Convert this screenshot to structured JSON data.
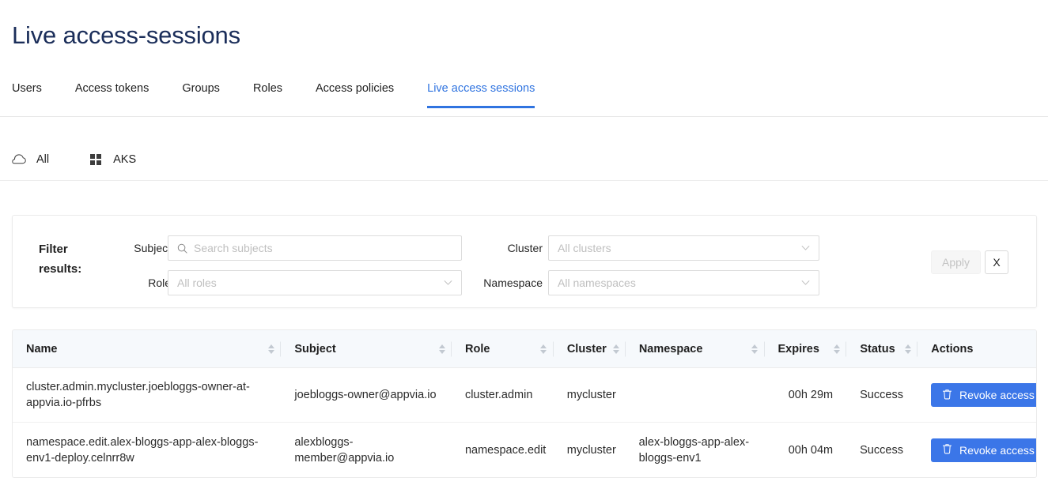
{
  "header": {
    "title": "Live access-sessions"
  },
  "tabs": [
    {
      "label": "Users",
      "active": false
    },
    {
      "label": "Access tokens",
      "active": false
    },
    {
      "label": "Groups",
      "active": false
    },
    {
      "label": "Roles",
      "active": false
    },
    {
      "label": "Access policies",
      "active": false
    },
    {
      "label": "Live access sessions",
      "active": true
    }
  ],
  "subtabs": [
    {
      "label": "All",
      "icon": "cloud-icon"
    },
    {
      "label": "AKS",
      "icon": "grid-icon"
    }
  ],
  "filter": {
    "title_line1": "Filter",
    "title_line2": "results:",
    "subject_label": "Subject",
    "subject_placeholder": "Search subjects",
    "role_label": "Role",
    "role_placeholder": "All roles",
    "cluster_label": "Cluster",
    "cluster_placeholder": "All clusters",
    "namespace_label": "Namespace",
    "namespace_placeholder": "All namespaces",
    "apply_label": "Apply",
    "clear_label": "X"
  },
  "table": {
    "columns": [
      {
        "label": "Name",
        "sortable": true
      },
      {
        "label": "Subject",
        "sortable": true
      },
      {
        "label": "Role",
        "sortable": true
      },
      {
        "label": "Cluster",
        "sortable": true
      },
      {
        "label": "Namespace",
        "sortable": true
      },
      {
        "label": "Expires",
        "sortable": true
      },
      {
        "label": "Status",
        "sortable": true
      },
      {
        "label": "Actions",
        "sortable": false
      }
    ],
    "rows": [
      {
        "name": "cluster.admin.mycluster.joebloggs-owner-at-appvia.io-pfrbs",
        "subject": "joebloggs-owner@appvia.io",
        "role": "cluster.admin",
        "cluster": "mycluster",
        "namespace": "",
        "expires": "00h 29m",
        "status": "Success",
        "action_label": "Revoke access"
      },
      {
        "name": "namespace.edit.alex-bloggs-app-alex-bloggs-env1-deploy.celnrr8w",
        "subject": "alexbloggs-member@appvia.io",
        "role": "namespace.edit",
        "cluster": "mycluster",
        "namespace": "alex-bloggs-app-alex-bloggs-env1",
        "expires": "00h 04m",
        "status": "Success",
        "action_label": "Revoke access"
      }
    ]
  },
  "colors": {
    "title": "#1b2e5a",
    "accent": "#3074e0",
    "button_primary": "#3b76e8",
    "header_bg": "#f6f9fc"
  }
}
